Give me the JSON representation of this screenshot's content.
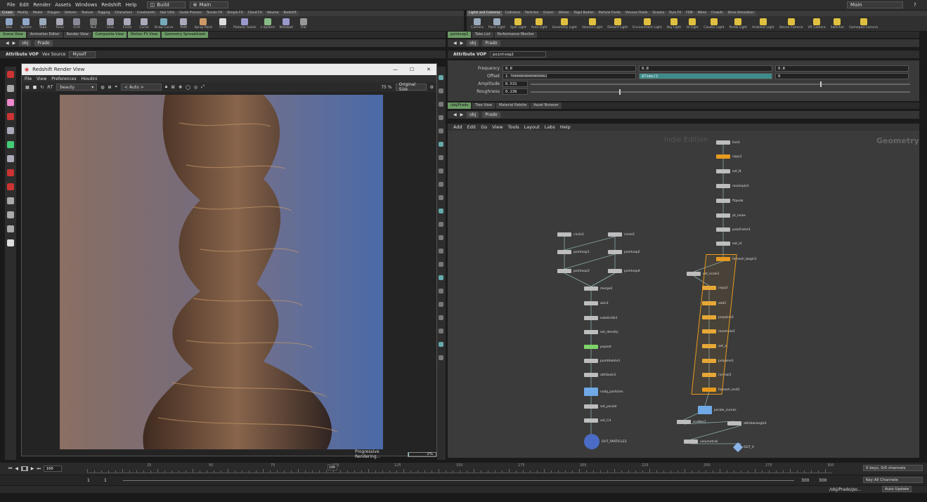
{
  "menubar": {
    "items": [
      "File",
      "Edit",
      "Render",
      "Assets",
      "Windows",
      "Redshift",
      "Help"
    ],
    "desktop": "Build",
    "desktop2": "Main",
    "right_desktop": "Main"
  },
  "shelf_left": {
    "tabs": [
      "Create",
      "Modify",
      "Model",
      "Polygon",
      "Deform",
      "Texture",
      "Rigging",
      "Characters",
      "Constraints",
      "Hair Utils",
      "Guide Process",
      "Terrain FX",
      "Simple FX",
      "Cloud FX",
      "Volume",
      "Redshift"
    ],
    "tools": [
      "Box",
      "Sphere",
      "Tube",
      "Torus",
      "Grid",
      "Null",
      "Line",
      "Circle",
      "Curve",
      "Draw Curve",
      "Path",
      "Spray Paint",
      "Font",
      "Platonic Solids",
      "L-System",
      "Metaball",
      "File"
    ]
  },
  "shelf_right": {
    "tabs": [
      "Lights and Cameras",
      "Collisions",
      "Particles",
      "Grains",
      "Vellum",
      "Rigid Bodies",
      "Particle Fluids",
      "Viscous Fluids",
      "Oceans",
      "Pyro FX",
      "FEM",
      "Wires",
      "Crowds",
      "Drive Simulation"
    ],
    "tools": [
      "Camera",
      "Point Light",
      "Spot Light",
      "Area Light",
      "Geometry Light",
      "Volume Light",
      "Distant Light",
      "Environment Light",
      "Sky Light",
      "GI Light",
      "Caustic Light",
      "Portal Light",
      "Ambient Light",
      "Stereo Camera",
      "VR Camera",
      "Switcher",
      "Gamepad Camera"
    ]
  },
  "pane_tabs_left": [
    "Scene View",
    "Animation Editor",
    "Render View",
    "Composite View",
    "Motion FX View",
    "Geometry Spreadsheet"
  ],
  "pane_tabs_right": [
    "pointvop2",
    "Take List",
    "Performance Monitor"
  ],
  "path_left": {
    "obj": "obj",
    "node": "Prado"
  },
  "path_right": {
    "obj": "obj",
    "node": "Prado"
  },
  "vop_left": {
    "type": "Attribute VOP",
    "label": "Vex Source",
    "value": "Myself"
  },
  "vop_right": {
    "type": "Attribute VOP",
    "name": "pointvop2"
  },
  "redshift": {
    "title": "Redshift Render View",
    "menu": [
      "File",
      "View",
      "Preferences",
      "Houdini"
    ],
    "rt": "RT",
    "aov": "beauty",
    "auto": "< Auto >",
    "zoom": "75 %",
    "size": "Original Size",
    "status": "Progressive Rendering...",
    "progress": "2%",
    "progress_value": 0.02
  },
  "params": [
    {
      "label": "Frequency",
      "v1": "0.8",
      "v2": "0.8",
      "v3": "0.8"
    },
    {
      "label": "Offset",
      "v1": "2.7000000000000002",
      "v2": "$Time/2",
      "v3": "0"
    },
    {
      "label": "Amplitude",
      "v1": "0.531"
    },
    {
      "label": "Roughness",
      "v1": "0.236"
    }
  ],
  "network_tabs": [
    "/obj/Prado",
    "Tree View",
    "Material Palette",
    "Asset Browser"
  ],
  "network_menu": [
    "Add",
    "Edit",
    "Go",
    "View",
    "Tools",
    "Layout",
    "Labs",
    "Help"
  ],
  "network_watermark_left": "Indie Edition",
  "network_watermark_right": "Geometry",
  "nodes_left": [
    "circle1",
    "circle2",
    "pointvop1",
    "pointvop2",
    "pointvop3",
    "pointvop4",
    "merge2",
    "skin1",
    "subdivide1",
    "set_density",
    "popnet",
    "pointdelete1",
    "attribute1",
    "rsobj_particles",
    "set_pscale",
    "set_Cd",
    "OUT_PARTICLES"
  ],
  "nodes_right": [
    "line1",
    "copy1",
    "set_N",
    "resample1",
    "fitpeak",
    "pt_noise",
    "polyframe1",
    "set_id",
    "foreach_begin1",
    "set_scale1",
    "copy2",
    "add1",
    "polywire2",
    "resample2",
    "set_a",
    "polywire1",
    "normal1",
    "foreach_end1",
    "pscale_curves",
    "scatter1",
    "attribwrangle1",
    "volumerasterizeattributes1",
    "volumetrail",
    "OUT_V"
  ],
  "timeline": {
    "frame": "100",
    "marker": "100",
    "ticks": [
      "25",
      "50",
      "75",
      "100",
      "125",
      "150",
      "175",
      "200",
      "225",
      "250",
      "275",
      "300"
    ],
    "keys": "0 keys, 0/0 channels",
    "key_all": "Key All Channels"
  },
  "range": {
    "start": "1",
    "start2": "1",
    "end": "300",
    "end2": "300"
  },
  "status": {
    "path": "/obj/Prado/po...",
    "update": "Auto Update"
  }
}
